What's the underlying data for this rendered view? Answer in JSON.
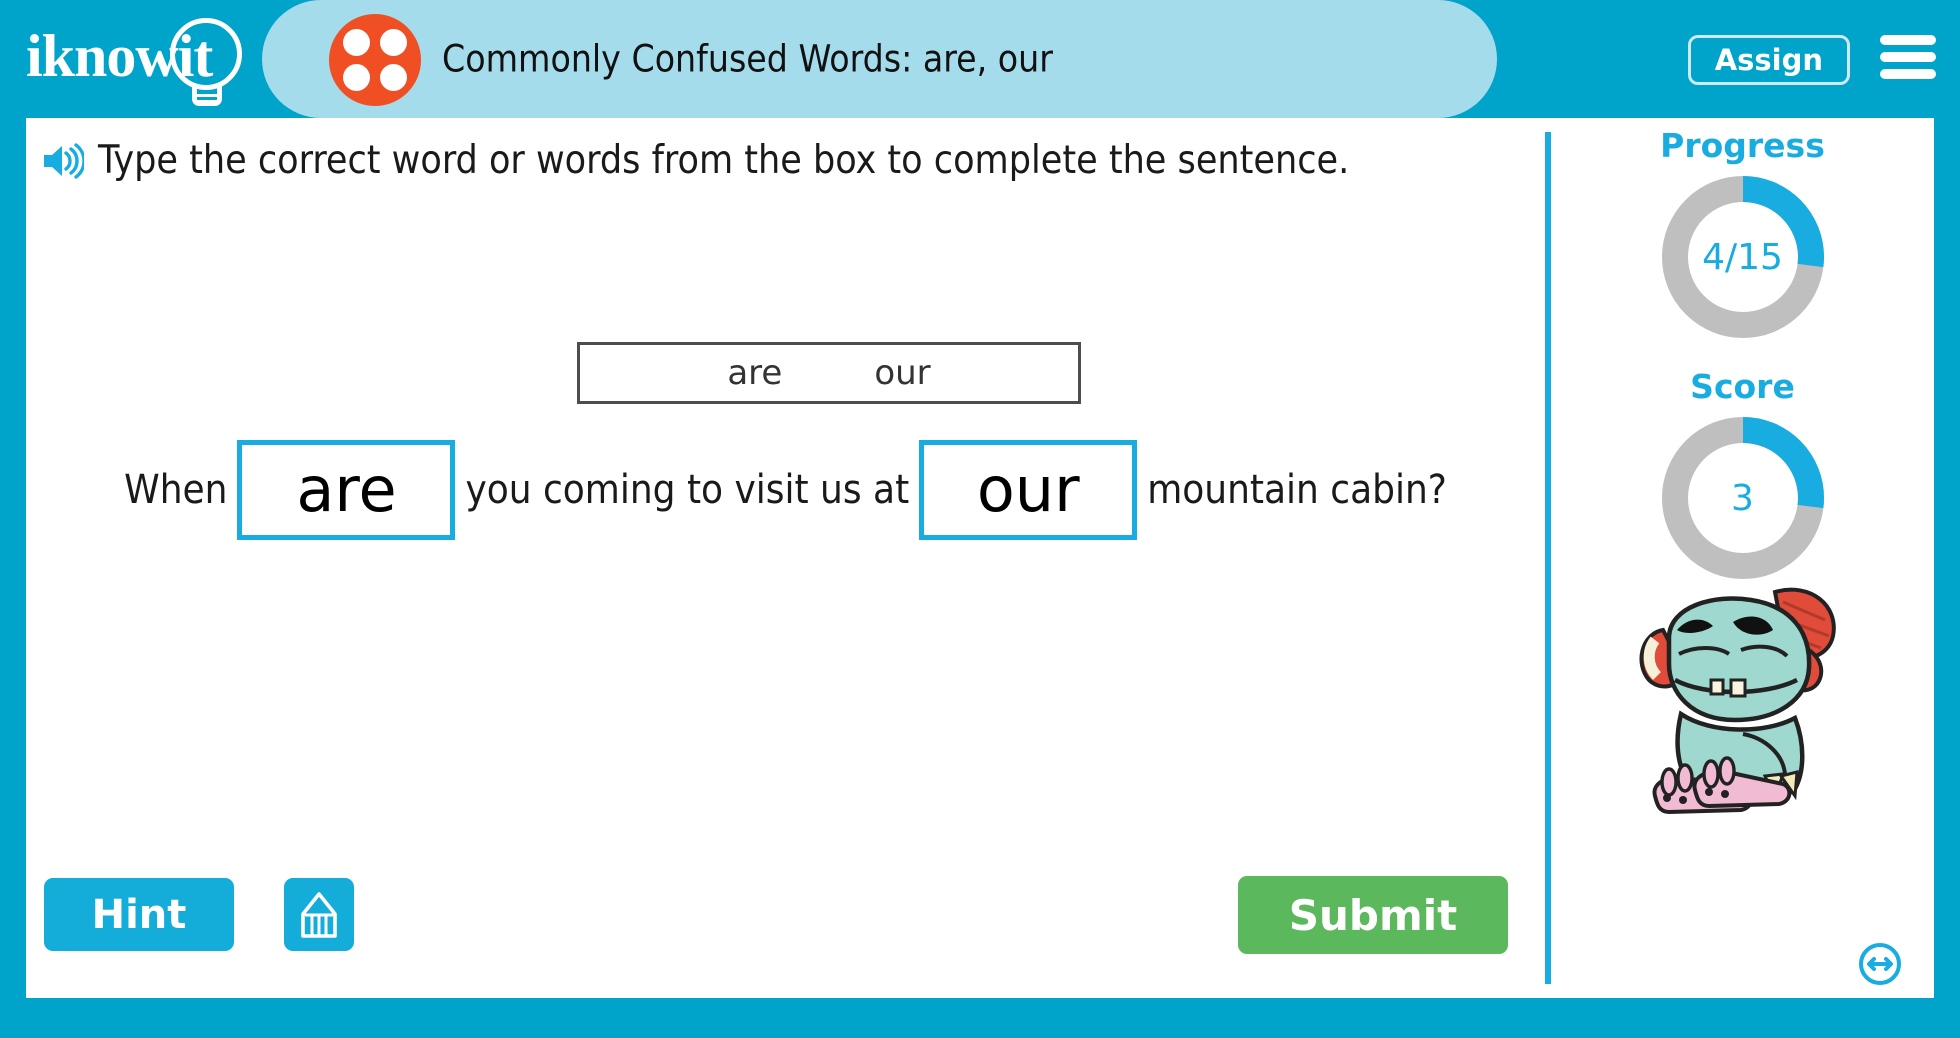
{
  "brand": {
    "logo_text": "iknowit",
    "logo_icon": "lightbulb-icon"
  },
  "header": {
    "subject_icon": "four-dots-circle-icon",
    "title": "Commonly Confused Words: are, our",
    "assign_label": "Assign",
    "menu_icon": "hamburger-menu-icon",
    "bar_color": "#00a3ca",
    "tab_color": "#a5dcec",
    "subject_icon_color": "#f04e23"
  },
  "question": {
    "audio_icon": "speaker-icon",
    "instruction": "Type the correct word or words from the box to complete the sentence.",
    "word_bank": [
      "are",
      "our"
    ],
    "sentence": {
      "before": "When",
      "blank1_value": "are",
      "middle": "you coming to visit us at",
      "blank2_value": "our",
      "after": "mountain cabin?"
    },
    "blank_border_color": "#18ace0"
  },
  "actions": {
    "hint_label": "Hint",
    "scratchpad_icon": "pencil-icon",
    "submit_label": "Submit",
    "hint_color": "#14ACD8",
    "submit_color": "#5cb85c"
  },
  "sidebar": {
    "progress": {
      "label": "Progress",
      "value_text": "4/15",
      "completed": 4,
      "total": 15,
      "percent": 27
    },
    "score": {
      "label": "Score",
      "value_text": "3",
      "percent": 27
    },
    "mascot_icon": "monster-mascot-icon",
    "resize_icon": "resize-horizontal-icon",
    "accent_color": "#18ace0",
    "track_color": "#bfbfbf"
  }
}
